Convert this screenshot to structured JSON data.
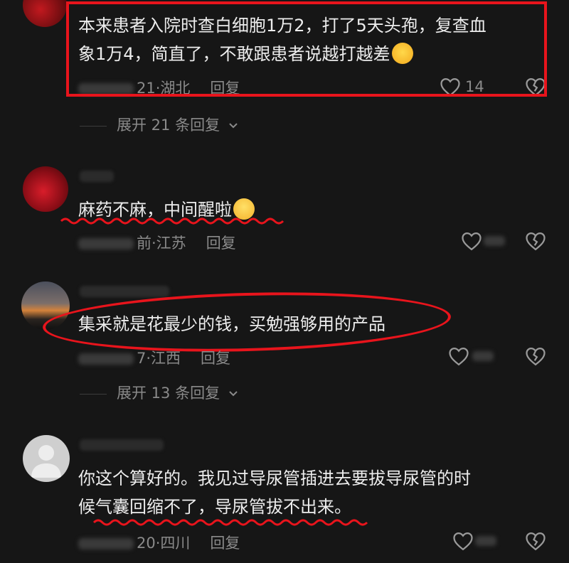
{
  "comments": [
    {
      "text_line1": "本来患者入院时查白细胞1万2，打了5天头孢，复查血",
      "text_line2": "象1万4，简直了，不敢跟患者说越打越差",
      "emoji": "laughing-crying-emoji",
      "meta_visible": "21·湖北",
      "reply": "回复",
      "likes": "14"
    },
    {
      "text": "麻药不麻，中间醒啦",
      "emoji": "crying-emoji",
      "meta_visible": "前·江苏",
      "reply": "回复"
    },
    {
      "text": "集采就是花最少的钱，买勉强够用的产品",
      "meta_visible": "7·江西",
      "reply": "回复"
    },
    {
      "text_line1": "你这个算好的。我见过导尿管插进去要拔导尿管的时",
      "text_line2": "候气囊回缩不了，导尿管拔不出来。",
      "meta_visible": "20·四川",
      "reply": "回复"
    }
  ],
  "expand_replies": [
    {
      "label": "展开 21 条回复"
    },
    {
      "label": "展开 13 条回复"
    }
  ],
  "colors": {
    "background": "#161616",
    "annotation_red": "#e8141c",
    "text": "#ededed",
    "meta": "#8a8a8a"
  }
}
